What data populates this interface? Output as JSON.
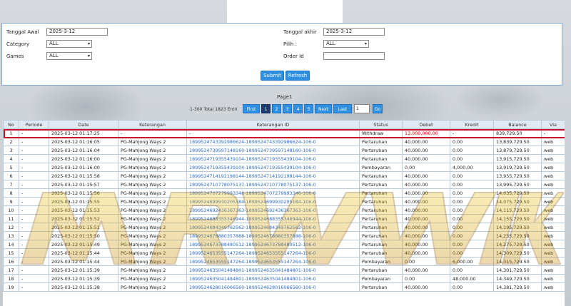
{
  "filters": {
    "tanggal_awal_label": "Tanggal Awal",
    "tanggal_awal_value": "2025-3-12",
    "tanggal_akhir_label": "Tanggal akhir",
    "tanggal_akhir_value": "2025-3-12",
    "category_label": "Category",
    "category_value": "ALL",
    "pilih_label": "Pilih :",
    "pilih_value": "ALL",
    "games_label": "Games",
    "games_value": "ALL",
    "order_id_label": "Order Id",
    "order_id_value": "",
    "submit_label": "Submit",
    "refresh_label": "Refresh"
  },
  "pager": {
    "title": "Page1",
    "total": "1-300 Total 1823 Entri",
    "first": "First",
    "pages": [
      "1",
      "2",
      "3",
      "4",
      "5"
    ],
    "next": "Next",
    "last": "Last",
    "input_value": "1",
    "go": "Go"
  },
  "watermark": "MRWWIK",
  "table": {
    "headers": [
      "No",
      "Periode",
      "Date",
      "Keterangan",
      "Keterangan ID",
      "Status",
      "Debet",
      "Kredit",
      "Balance",
      "Via"
    ],
    "rows": [
      [
        "1",
        "-",
        "2025-03-12 01:17:25",
        "-",
        "-",
        "Withdraw",
        "13,000,000.00",
        "-",
        "839,729.50",
        "-"
      ],
      [
        "2",
        "-",
        "2025-03-12 01:16:05",
        "PG-Mahjong Ways 2",
        "1899524743392986624-1899524743392986624-106-0",
        "Pertaruhan",
        "40,000.00",
        "0.00",
        "13,839,729.50",
        "web"
      ],
      [
        "3",
        "-",
        "2025-03-12 01:16:04",
        "PG-Mahjong Ways 2",
        "1899524739597148160-1899524739597148160-106-0",
        "Pertaruhan",
        "40,000.00",
        "0.00",
        "13,879,729.50",
        "web"
      ],
      [
        "4",
        "-",
        "2025-03-12 01:16:00",
        "PG-Mahjong Ways 2",
        "1899524719355439104-1899524719355439104-106-0",
        "Pertaruhan",
        "40,000.00",
        "0.00",
        "13,915,729.50",
        "web"
      ],
      [
        "5",
        "-",
        "2025-03-12 01:16:00",
        "PG-Mahjong Ways 2",
        "1899524719355439104-1899524719355439104-106-0",
        "Pembayaran",
        "0.00",
        "4,000.00",
        "13,919,729.50",
        "web"
      ],
      [
        "6",
        "-",
        "2025-03-12 01:15:58",
        "PG-Mahjong Ways 2",
        "1899524714192198144-1899524714192198144-106-0",
        "Pertaruhan",
        "40,000.00",
        "0.00",
        "13,955,729.50",
        "web"
      ],
      [
        "7",
        "-",
        "2025-03-12 01:15:57",
        "PG-Mahjong Ways 2",
        "1899524710778075137-1899524710778075137-106-0",
        "Pertaruhan",
        "40,000.00",
        "0.00",
        "13,995,729.50",
        "web"
      ],
      [
        "8",
        "-",
        "2025-03-12 01:15:56",
        "PG-Mahjong Ways 2",
        "1899524707279993346-1899524707279993346-106-0",
        "Pertaruhan",
        "40,000.00",
        "0.00",
        "14,035,729.50",
        "web"
      ],
      [
        "9",
        "-",
        "2025-03-12 01:15:55",
        "PG-Mahjong Ways 2",
        "1899524699930205184-1899524699930205184-106-0",
        "Pertaruhan",
        "40,000.00",
        "0.00",
        "14,075,729.50",
        "web"
      ],
      [
        "10",
        "-",
        "2025-03-12 01:15:53",
        "PG-Mahjong Ways 2",
        "1899524692436367363-1899524692436367363-106-0",
        "Pertaruhan",
        "40,000.00",
        "0.00",
        "14,115,729.50",
        "web"
      ],
      [
        "11",
        "-",
        "2025-03-12 01:15:52",
        "PG-Mahjong Ways 2",
        "1899524688355346944-1899524688355346944-106-0",
        "Pertaruhan",
        "40,000.00",
        "0.00",
        "14,155,729.50",
        "web"
      ],
      [
        "12",
        "-",
        "2025-03-12 01:15:51",
        "PG-Mahjong Ways 2",
        "1899524684349762562-1899524684349762562-106-0",
        "Pertaruhan",
        "40,000.00",
        "0.00",
        "14,195,729.50",
        "web"
      ],
      [
        "13",
        "-",
        "2025-03-12 01:15:50",
        "PG-Mahjong Ways 2",
        "1899524678880357888-1899524678880357888-106-0",
        "Pertaruhan",
        "40,000.00",
        "0.00",
        "14,235,729.50",
        "web"
      ],
      [
        "14",
        "-",
        "2025-03-12 01:15:49",
        "PG-Mahjong Ways 2",
        "1899524673788480512-1899524673788480512-106-0",
        "Pertaruhan",
        "40,000.00",
        "0.00",
        "14,275,729.50",
        "web"
      ],
      [
        "15",
        "-",
        "2025-03-12 01:15:44",
        "PG-Mahjong Ways 2",
        "1899524653555147264-1899524653555147264-106-0",
        "Pertaruhan",
        "40,000.00",
        "0.00",
        "14,309,729.50",
        "web"
      ],
      [
        "16",
        "-",
        "2025-03-12 01:15:44",
        "PG-Mahjong Ways 2",
        "1899524653555147264-1899524653555147264-106-0",
        "Pembayaran",
        "0.00",
        "6,000.00",
        "14,315,729.50",
        "web"
      ],
      [
        "17",
        "-",
        "2025-03-12 01:15:39",
        "PG-Mahjong Ways 2",
        "1899524635041484801-1899524635041484801-106-0",
        "Pertaruhan",
        "40,000.00",
        "0.00",
        "14,301,729.50",
        "web"
      ],
      [
        "18",
        "-",
        "2025-03-12 01:15:39",
        "PG-Mahjong Ways 2",
        "1899524635041484801-1899524635041484801-106-0",
        "Pembayaran",
        "0.00",
        "48,000.00",
        "14,349,729.50",
        "web"
      ],
      [
        "19",
        "-",
        "2025-03-12 01:15:38",
        "PG-Mahjong Ways 2",
        "1899524628016066560-1899524628016066560-106-0",
        "Pertaruhan",
        "40,000.00",
        "0.00",
        "14,381,729.50",
        "web"
      ]
    ]
  }
}
